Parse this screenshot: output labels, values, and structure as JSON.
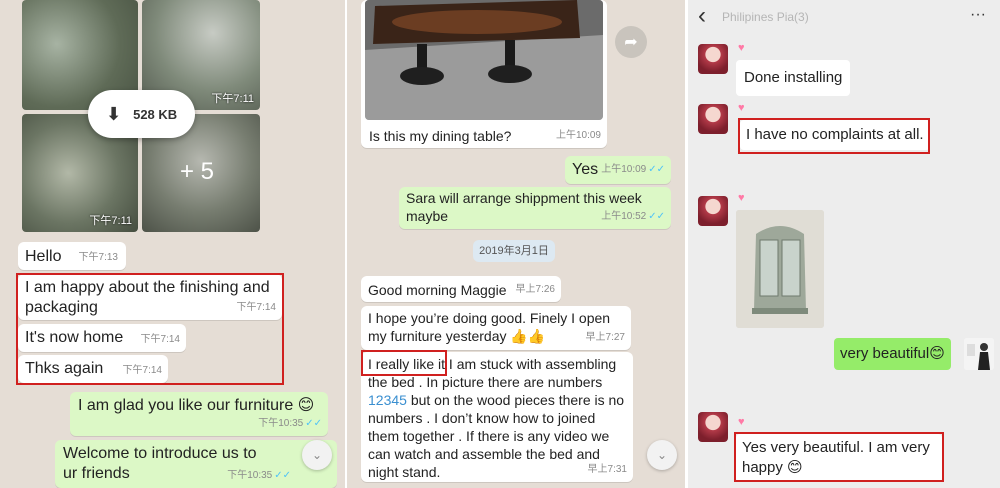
{
  "panel1": {
    "media": {
      "size": "528 KB",
      "time_tr": "下午7:11",
      "time_bl": "下午7:11",
      "more": "+ 5"
    },
    "messages": [
      {
        "text": "Hello",
        "time": "下午7:13"
      },
      {
        "text": "I am happy about the finishing and packaging",
        "time": "下午7:14"
      },
      {
        "text": "It's now home",
        "time": "下午7:14"
      },
      {
        "text": "Thks again",
        "time": "下午7:14"
      }
    ],
    "out": [
      {
        "text": "I am glad you like our furniture 😊",
        "time": "下午10:35"
      },
      {
        "text": "Welcome to introduce us to ur friends",
        "time": "下午10:35"
      }
    ]
  },
  "panel2": {
    "table_caption": "Is this my dining table?",
    "table_time": "上午10:09",
    "yes": {
      "text": "Yes",
      "time": "上午10:09"
    },
    "ship": {
      "text": "Sara will arrange shippment this week maybe",
      "time": "上午10:52"
    },
    "date_chip": "2019年3月1日",
    "morning": {
      "text": "Good morning Maggie",
      "time": "早上7:26"
    },
    "hope": {
      "text": "I hope you’re doing good. Finely I open my furniture yesterday 👍👍",
      "time": "早上7:27"
    },
    "like_highlight": "I really like it",
    "long_rest_1": " I am stuck with assembling the bed . In picture there are numbers ",
    "long_link": "12345",
    "long_rest_2": " but on the wood pieces there is no numbers . I don’t know how to joined them together . If there is any video we can watch and assemble the bed and night stand.",
    "long_time": "早上7:31"
  },
  "panel3": {
    "title": "Philipines Pia(3)",
    "more": "···",
    "back": "‹",
    "m1": "Done installing",
    "m2": "I have no complaints at all.",
    "m3": "very beautiful😊",
    "m4": "Yes very beautiful. I am very happy 😊",
    "heart": "♥"
  },
  "colors": {
    "highlight": "#d0201f",
    "outgoing_wa": "#dcf8c6",
    "outgoing_wc": "#95ec69"
  }
}
